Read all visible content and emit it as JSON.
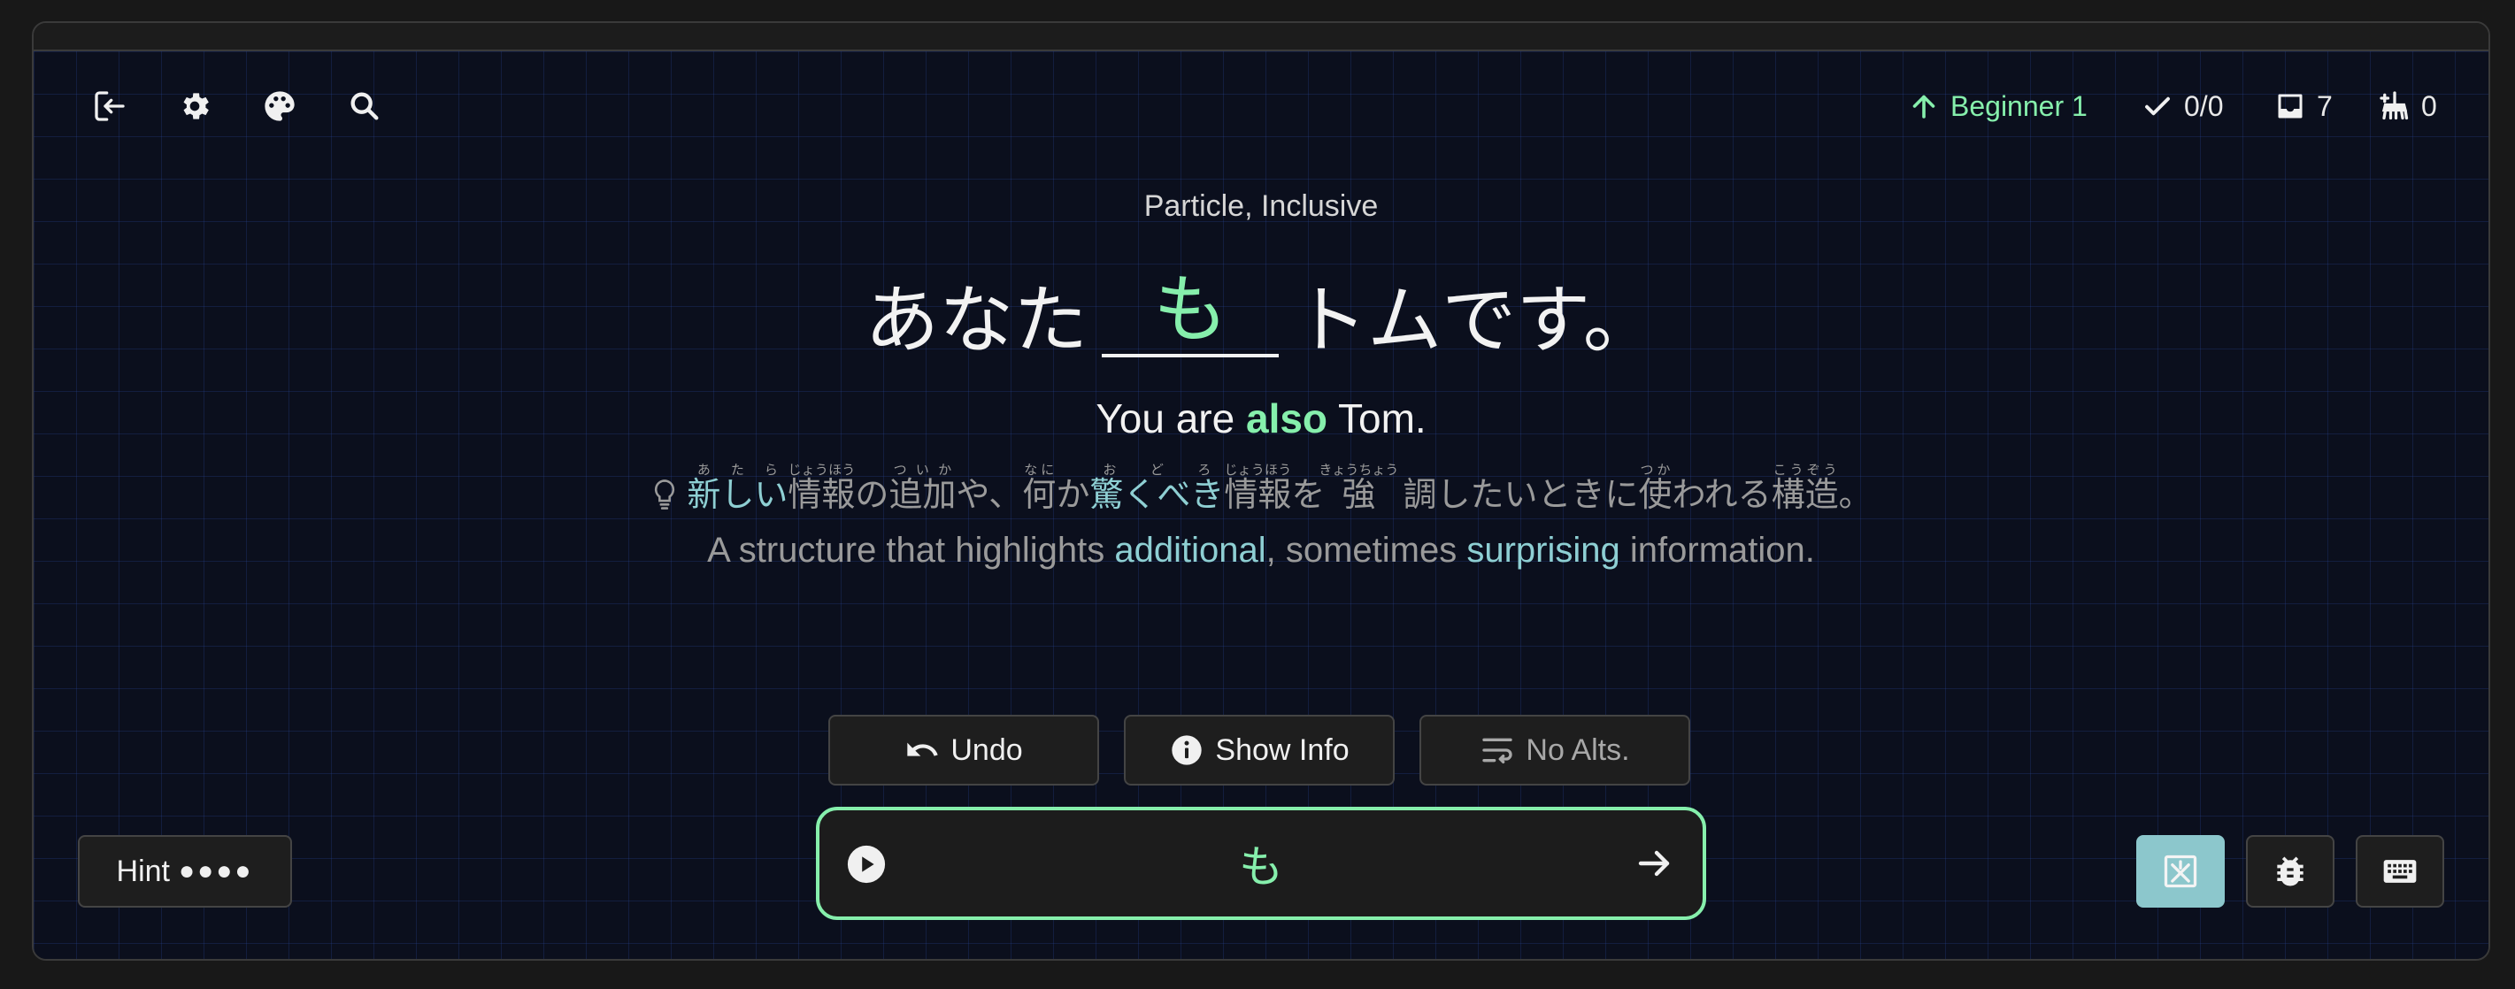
{
  "toolbar": {
    "exit_icon": "exit-icon",
    "settings_icon": "gear-icon",
    "theme_icon": "palette-icon",
    "search_icon": "search-icon"
  },
  "stats": {
    "level": "Beginner 1",
    "correct": "0/0",
    "inbox": "7",
    "cleared": "0"
  },
  "question": {
    "grammar_tags": "Particle, Inclusive",
    "sentence_before": "あなた",
    "blank_answer": "も",
    "sentence_after": "トムです。",
    "translation_before": "You are ",
    "translation_highlight": "also",
    "translation_after": " Tom."
  },
  "explanation": {
    "jp_segments": [
      {
        "text": "新しい",
        "ruby": "あたら",
        "teal": true
      },
      {
        "text": "情報",
        "ruby": "じょうほう",
        "teal": false
      },
      {
        "text": "の",
        "ruby": "",
        "teal": false
      },
      {
        "text": "追加",
        "ruby": "ついか",
        "teal": false
      },
      {
        "text": "や、",
        "ruby": "",
        "teal": false
      },
      {
        "text": "何",
        "ruby": "なに",
        "teal": false
      },
      {
        "text": "か",
        "ruby": "",
        "teal": false
      },
      {
        "text": "驚くべき",
        "ruby": "おどろ",
        "teal": true
      },
      {
        "text": "情報",
        "ruby": "じょうほう",
        "teal": false
      },
      {
        "text": "を",
        "ruby": "",
        "teal": false
      },
      {
        "text": "強",
        "ruby": "きょうちょう",
        "teal": false
      },
      {
        "text": " 調したいときに",
        "ruby": "",
        "teal": false
      },
      {
        "text": "使",
        "ruby": "つか",
        "teal": false
      },
      {
        "text": "われる",
        "ruby": "",
        "teal": false
      },
      {
        "text": "構造",
        "ruby": "こうぞう",
        "teal": false
      },
      {
        "text": "。",
        "ruby": "",
        "teal": false
      }
    ],
    "en_before": "A structure that highlights ",
    "en_hl1": "additional",
    "en_middle": ", sometimes ",
    "en_hl2": "surprising",
    "en_after": " information."
  },
  "actions": {
    "undo_label": "Undo",
    "info_label": "Show Info",
    "alts_label": "No Alts."
  },
  "answer": {
    "value": "も"
  },
  "hint": {
    "label": "Hint",
    "dots": "●●●●"
  },
  "corner": {
    "furigana_icon": "furigana-icon",
    "bug_icon": "bug-icon",
    "keyboard_icon": "keyboard-icon"
  },
  "colors": {
    "accent_green": "#86efac",
    "teal": "#8ecfd3",
    "board": "#0b0f1d"
  }
}
